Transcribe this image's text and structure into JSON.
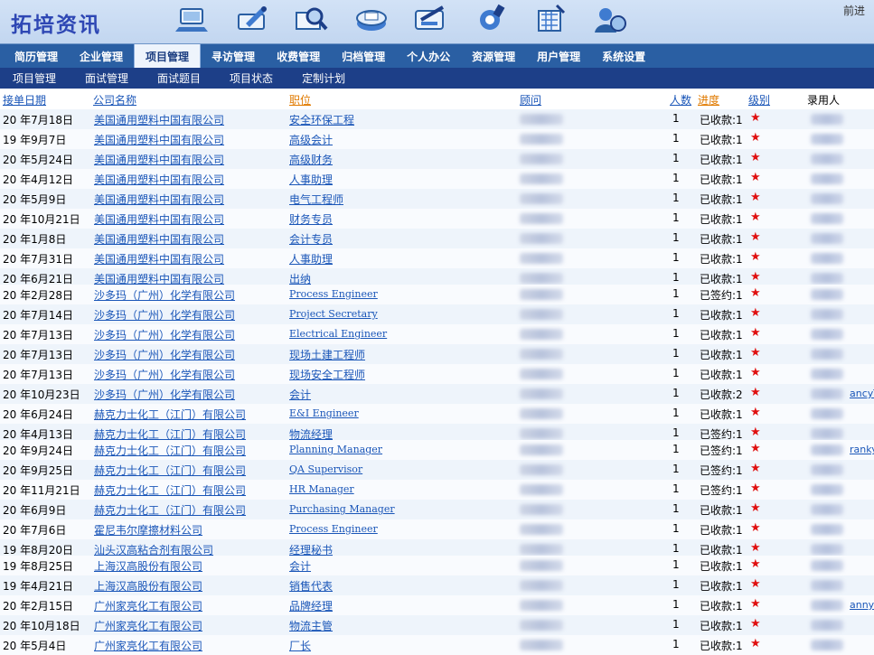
{
  "app": {
    "logo": "拓培资讯",
    "forward_link": "前进"
  },
  "top_icons": [
    "computer-icon",
    "pencil-edit-icon",
    "search-magnifier-icon",
    "document-stack-icon",
    "pen-tool-icon",
    "settings-icon",
    "calculator-icon",
    "user-globe-icon"
  ],
  "main_nav": {
    "items": [
      "简历管理",
      "企业管理",
      "项目管理",
      "寻访管理",
      "收费管理",
      "归档管理",
      "个人办公",
      "资源管理",
      "用户管理",
      "系统设置"
    ],
    "active_index": 2
  },
  "sub_nav": {
    "items": [
      "项目管理",
      "面试管理",
      "面试题目",
      "项目状态",
      "定制计划"
    ]
  },
  "table": {
    "headers": {
      "date": "接单日期",
      "company": "公司名称",
      "position": "职位",
      "consultant": "顾问",
      "count": "人数",
      "progress": "进度",
      "level": "级别",
      "hired": "录用人"
    },
    "rows": [
      {
        "date": "20  年7月18日",
        "company": "美国通用塑料中国有限公司",
        "position": "安全环保工程",
        "cn": true,
        "count": "1",
        "status": "已收款:1",
        "level": "★",
        "extra": ""
      },
      {
        "date": "19  年9月7日",
        "company": "美国通用塑料中国有限公司",
        "position": "高级会计",
        "cn": true,
        "count": "1",
        "status": "已收款:1",
        "level": "★",
        "extra": ""
      },
      {
        "date": "20  年5月24日",
        "company": "美国通用塑料中国有限公司",
        "position": "高级财务",
        "cn": true,
        "count": "1",
        "status": "已收款:1",
        "level": "★",
        "extra": ""
      },
      {
        "date": "20  年4月12日",
        "company": "美国通用塑料中国有限公司",
        "position": "人事助理",
        "cn": true,
        "count": "1",
        "status": "已收款:1",
        "level": "★",
        "extra": ""
      },
      {
        "date": "20  年5月9日",
        "company": "美国通用塑料中国有限公司",
        "position": "电气工程师",
        "cn": true,
        "count": "1",
        "status": "已收款:1",
        "level": "★",
        "extra": ""
      },
      {
        "date": "20  年10月21日",
        "company": "美国通用塑料中国有限公司",
        "position": "财务专员",
        "cn": true,
        "count": "1",
        "status": "已收款:1",
        "level": "★",
        "extra": ""
      },
      {
        "date": "20  年1月8日",
        "company": "美国通用塑料中国有限公司",
        "position": "会计专员",
        "cn": true,
        "count": "1",
        "status": "已收款:1",
        "level": "★",
        "extra": ""
      },
      {
        "date": "20  年7月31日",
        "company": "美国通用塑料中国有限公司",
        "position": "人事助理",
        "cn": true,
        "count": "1",
        "status": "已收款:1",
        "level": "★",
        "extra": ""
      },
      {
        "date": "20  年6月21日",
        "company": "美国通用塑料中国有限公司",
        "position": "出纳",
        "cn": true,
        "count": "1",
        "status": "已收款:1",
        "level": "★",
        "extra": ""
      },
      {
        "date": "20  年2月28日",
        "company": "沙多玛（广州）化学有限公司",
        "position": "Process Engineer",
        "cn": false,
        "count": "1",
        "status": "已签约:1",
        "level": "★",
        "extra": ""
      },
      {
        "date": "20  年7月14日",
        "company": "沙多玛（广州）化学有限公司",
        "position": "Project Secretary",
        "cn": false,
        "count": "1",
        "status": "已收款:1",
        "level": "★",
        "extra": ""
      },
      {
        "date": "20  年7月13日",
        "company": "沙多玛（广州）化学有限公司",
        "position": "Electrical Engineer",
        "cn": false,
        "count": "1",
        "status": "已收款:1",
        "level": "★",
        "extra": ""
      },
      {
        "date": "20  年7月13日",
        "company": "沙多玛（广州）化学有限公司",
        "position": "现场土建工程师",
        "cn": true,
        "count": "1",
        "status": "已收款:1",
        "level": "★",
        "extra": ""
      },
      {
        "date": "20  年7月13日",
        "company": "沙多玛（广州）化学有限公司",
        "position": "现场安全工程师",
        "cn": true,
        "count": "1",
        "status": "已收款:1",
        "level": "★",
        "extra": ""
      },
      {
        "date": "20  年10月23日",
        "company": "沙多玛（广州）化学有限公司",
        "position": "会计",
        "cn": true,
        "count": "1",
        "status": "已收款:2",
        "level": "★",
        "extra": "ancyT"
      },
      {
        "date": "20  年6月24日",
        "company": "赫克力士化工（江门）有限公司",
        "position": "E&I Engineer",
        "cn": false,
        "count": "1",
        "status": "已收款:1",
        "level": "★",
        "extra": ""
      },
      {
        "date": "20  年4月13日",
        "company": "赫克力士化工（江门）有限公司",
        "position": "物流经理",
        "cn": true,
        "count": "1",
        "status": "已签约:1",
        "level": "★",
        "extra": ""
      },
      {
        "date": "20  年9月24日",
        "company": "赫克力士化工（江门）有限公司",
        "position": "Planning Manager",
        "cn": false,
        "count": "1",
        "status": "已签约:1",
        "level": "★",
        "extra": "ranky"
      },
      {
        "date": "20  年9月25日",
        "company": "赫克力士化工（江门）有限公司",
        "position": "QA Supervisor",
        "cn": false,
        "count": "1",
        "status": "已签约:1",
        "level": "★",
        "extra": ""
      },
      {
        "date": "20  年11月21日",
        "company": "赫克力士化工（江门）有限公司",
        "position": "HR Manager",
        "cn": false,
        "count": "1",
        "status": "已签约:1",
        "level": "★",
        "extra": ""
      },
      {
        "date": "20  年6月9日",
        "company": "赫克力士化工（江门）有限公司",
        "position": "Purchasing Manager",
        "cn": false,
        "count": "1",
        "status": "已收款:1",
        "level": "★",
        "extra": ""
      },
      {
        "date": "20  年7月6日",
        "company": "霍尼韦尔摩擦材料公司",
        "position": "Process Engineer",
        "cn": false,
        "count": "1",
        "status": "已收款:1",
        "level": "★",
        "extra": ""
      },
      {
        "date": "19  年8月20日",
        "company": "汕头汉高粘合剂有限公司",
        "position": "经理秘书",
        "cn": true,
        "count": "1",
        "status": "已收款:1",
        "level": "★",
        "extra": ""
      },
      {
        "date": "19  年8月25日",
        "company": "上海汉高股份有限公司",
        "position": "会计",
        "cn": true,
        "count": "1",
        "status": "已收款:1",
        "level": "★",
        "extra": ""
      },
      {
        "date": "19  年4月21日",
        "company": "上海汉高股份有限公司",
        "position": "销售代表",
        "cn": true,
        "count": "1",
        "status": "已收款:1",
        "level": "★",
        "extra": ""
      },
      {
        "date": "20  年2月15日",
        "company": "广州家亮化工有限公司",
        "position": "品牌经理",
        "cn": true,
        "count": "1",
        "status": "已收款:1",
        "level": "★",
        "extra": "anny"
      },
      {
        "date": "20  年10月18日",
        "company": "广州家亮化工有限公司",
        "position": "物流主管",
        "cn": true,
        "count": "1",
        "status": "已收款:1",
        "level": "★",
        "extra": ""
      },
      {
        "date": "20  年5月4日",
        "company": "广州家亮化工有限公司",
        "position": "厂长",
        "cn": true,
        "count": "1",
        "status": "已收款:1",
        "level": "★",
        "extra": ""
      }
    ]
  },
  "colors": {
    "nav_bg": "#2a5fa3",
    "subnav_bg": "#1d3f88",
    "link": "#1a56b8",
    "star": "#e01010",
    "logo": "#2e47b4"
  }
}
